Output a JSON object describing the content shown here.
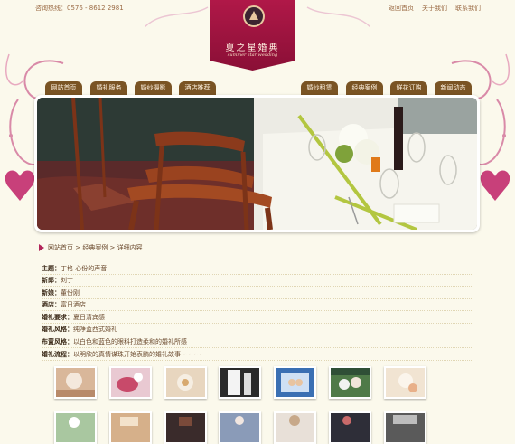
{
  "header": {
    "hotline": "咨询热线：0576 - 8612 2981",
    "links": [
      "返回首页",
      "关于我们",
      "联系我们"
    ],
    "logo": {
      "cn": "夏之星婚典",
      "en": "summer star wedding"
    }
  },
  "nav": {
    "left": [
      "网站首页",
      "婚礼服务",
      "婚纱摄影",
      "酒店推荐"
    ],
    "right": [
      "婚纱租赁",
      "经典案例",
      "鲜花订购",
      "新闻动态"
    ]
  },
  "breadcrumb": {
    "home": "网站首页",
    "sep1": " > ",
    "section": "经典案例",
    "sep2": " > ",
    "current": "详细内容"
  },
  "details": [
    {
      "label": "主题：",
      "value": "丁格 心份的声音"
    },
    {
      "label": "新郎：",
      "value": "刘丁"
    },
    {
      "label": "新娘：",
      "value": "董份刚"
    },
    {
      "label": "酒店：",
      "value": "富日酒店"
    },
    {
      "label": "婚礼要求：",
      "value": "夏日清宾感"
    },
    {
      "label": "婚礼风格：",
      "value": "纯净蓝西式婚礼"
    },
    {
      "label": "布置风格：",
      "value": "以白色和蓝色的眼科打造柔和的婚礼所感"
    },
    {
      "label": "婚礼流程：",
      "value": "以明欣的真情谋珠开始表鹏的婚礼故事~~~~"
    }
  ],
  "colors": {
    "background": "#fbf9ec",
    "nav_tab": "#7a5424",
    "logo": "#a0143f",
    "accent": "#b2255a"
  }
}
